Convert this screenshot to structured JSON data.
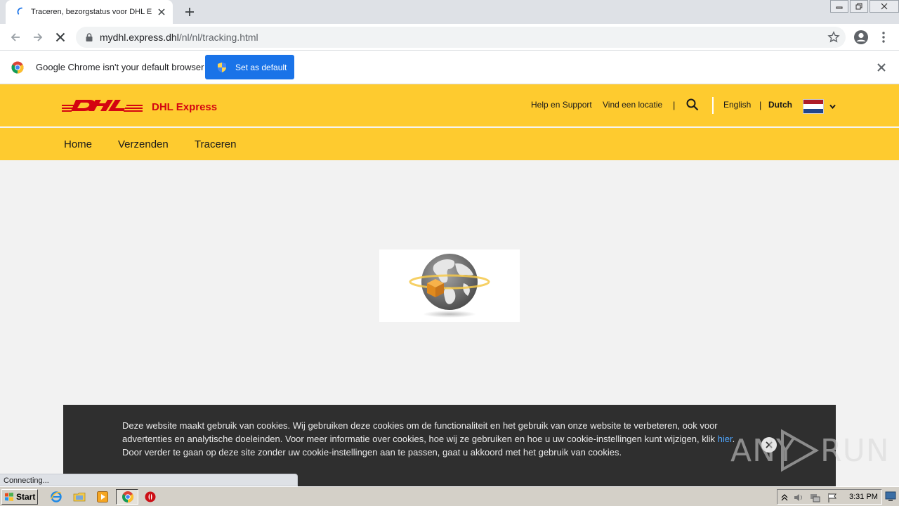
{
  "browser": {
    "tab_title": "Traceren, bezorgstatus voor DHL Express",
    "url_host": "mydhl.express.dhl",
    "url_path": "/nl/nl/tracking.html",
    "status_text": "Connecting..."
  },
  "infobar": {
    "message": "Google Chrome isn't your default browser",
    "button_label": "Set as default"
  },
  "dhl": {
    "brand_label": "DHL Express",
    "top_links": {
      "help": "Help en Support",
      "locate": "Vind een locatie",
      "english": "English",
      "dutch": "Dutch"
    },
    "nav": [
      "Home",
      "Verzenden",
      "Traceren"
    ]
  },
  "cookie": {
    "text_before_link": "Deze website maakt gebruik van cookies. Wij gebruiken deze cookies om de functionaliteit en het gebruik van onze website te verbeteren, ook voor advertenties en analytische doeleinden. Voor meer informatie over cookies, hoe wij ze gebruiken en hoe u uw cookie-instellingen kunt wijzigen, klik ",
    "link_text": "hier",
    "text_after_link": ". Door verder te gaan op deze site zonder uw cookie-instellingen aan te passen, gaat u akkoord met het gebruik van cookies."
  },
  "watermark": {
    "left": "ANY",
    "right": "RUN"
  },
  "taskbar": {
    "start_label": "Start",
    "clock": "3:31 PM"
  },
  "colors": {
    "dhl_yellow": "#fecb2f",
    "dhl_red": "#d40511",
    "chrome_blue": "#1a73e8",
    "cookie_bg": "#2f2f2f"
  },
  "icons": [
    "loading-spinner-icon",
    "close-icon",
    "plus-icon",
    "back-arrow-icon",
    "forward-arrow-icon",
    "stop-icon",
    "lock-icon",
    "star-icon",
    "profile-icon",
    "menu-dots-icon",
    "chrome-logo-icon",
    "shield-icon",
    "dhl-logo",
    "search-icon",
    "netherlands-flag-icon",
    "chevron-down-icon",
    "globe-package-icon",
    "windows-logo-icon",
    "ie-icon",
    "folder-icon",
    "media-player-icon",
    "chrome-icon",
    "opera-icon"
  ]
}
